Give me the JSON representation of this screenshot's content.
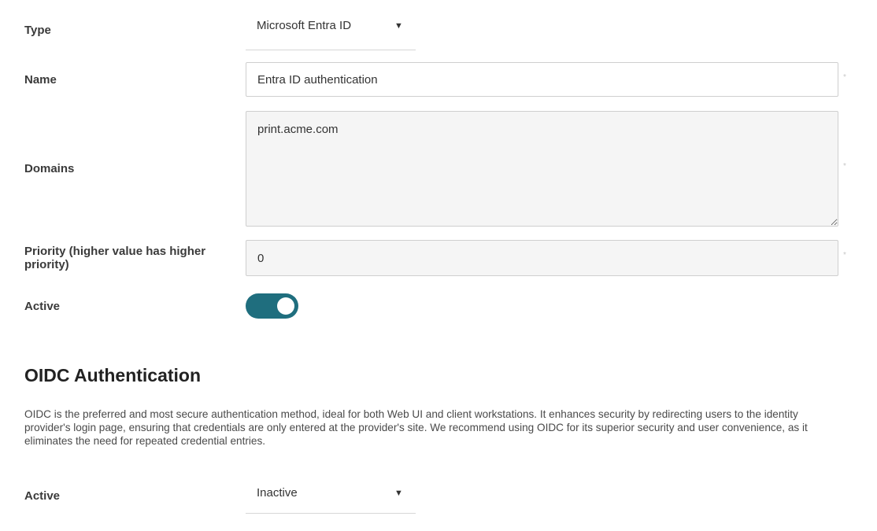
{
  "fields": {
    "type": {
      "label": "Type",
      "value": "Microsoft Entra ID"
    },
    "name": {
      "label": "Name",
      "value": "Entra ID authentication",
      "required_mark": "*"
    },
    "domains": {
      "label": "Domains",
      "value": "print.acme.com",
      "required_mark": "*"
    },
    "priority": {
      "label": "Priority (higher value has higher priority)",
      "value": "0",
      "required_mark": "*"
    },
    "active": {
      "label": "Active",
      "checked": true
    }
  },
  "oidc": {
    "title": "OIDC Authentication",
    "description": "OIDC is the preferred and most secure authentication method, ideal for both Web UI and client workstations. It enhances security by redirecting users to the identity provider's login page, ensuring that credentials are only entered at the provider's site. We recommend using OIDC for its superior security and user convenience, as it eliminates the need for repeated credential entries.",
    "active": {
      "label": "Active",
      "value": "Inactive"
    }
  },
  "icons": {
    "dropdown": "caret-down-icon",
    "caret_glyph": "▼"
  },
  "colors": {
    "toggle_on": "#1f6e7e",
    "input_bg": "#f5f5f5"
  }
}
